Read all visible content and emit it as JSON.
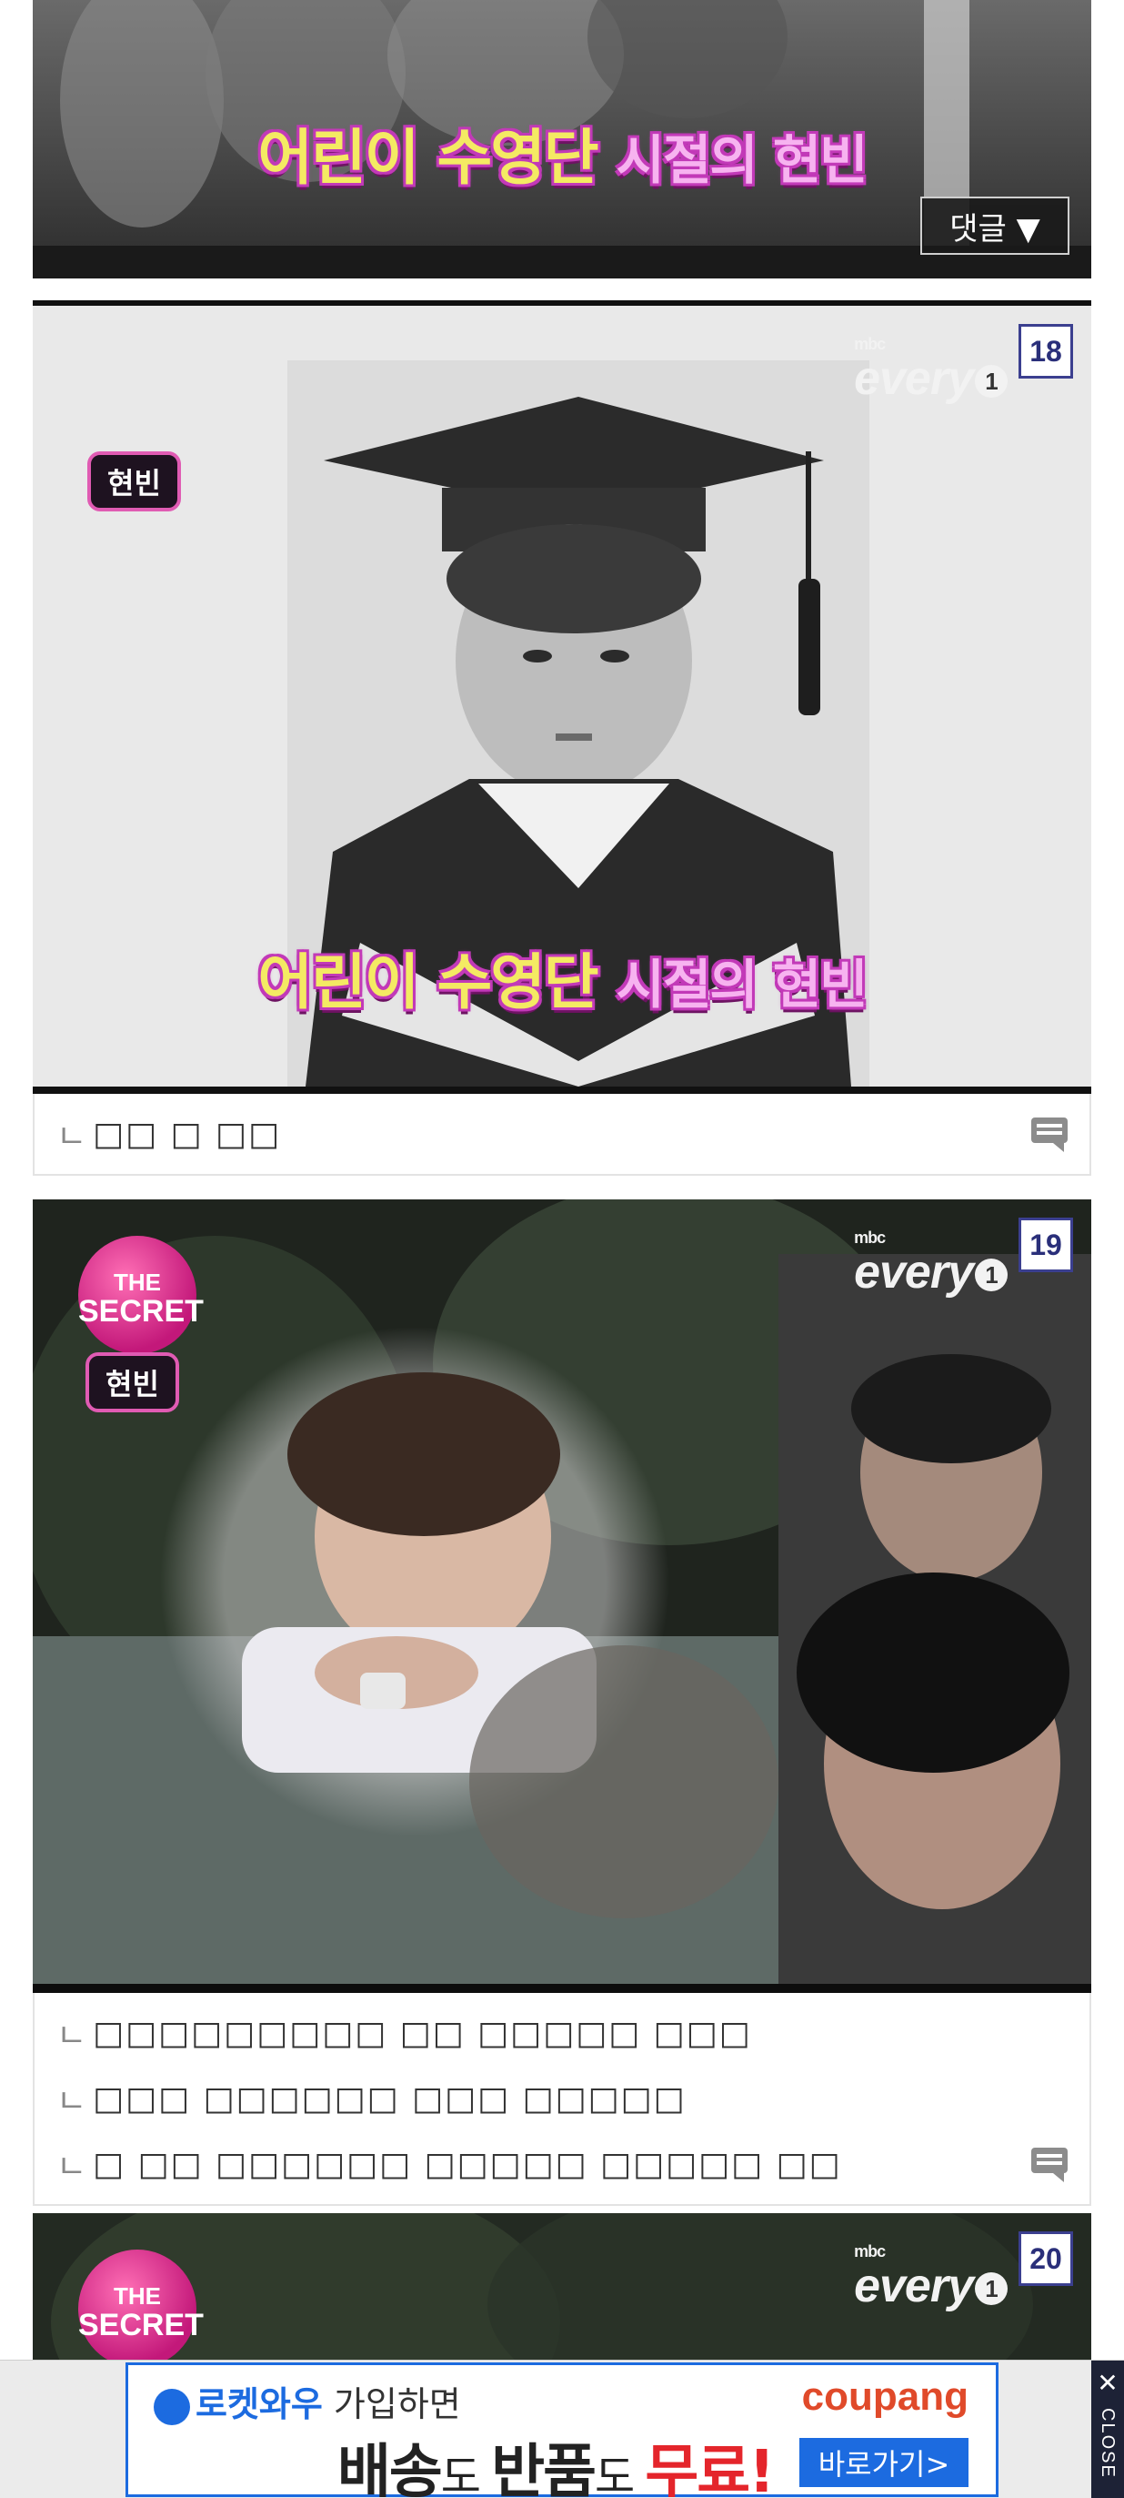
{
  "cards": [
    {
      "caption_white": "어린이 수영단",
      "caption_pink": "시절의 현빈",
      "comment_button": "댓글 ▼"
    },
    {
      "number": "18",
      "name_tag": "현빈",
      "caption_white": "어린이 수영단",
      "caption_pink": "시절의 현빈",
      "comments": [
        "ㄴ",
        "□□ □ □□"
      ]
    },
    {
      "number": "19",
      "secret_top": "THE",
      "secret_bottom": "SECRET",
      "name_tag": "현빈",
      "comments": [
        {
          "arrow": "ㄴ",
          "text": "□□□□□□□□□ □□ □□□□□ □□□"
        },
        {
          "arrow": "ㄴ",
          "text": "□□□ □□□□□□ □□□ □□□□□"
        },
        {
          "arrow": "ㄴ",
          "text": "□ □□ □□□□□□ □□□□□ □□□□□ □□"
        }
      ]
    },
    {
      "number": "20",
      "secret_top": "THE",
      "secret_bottom": "SECRET"
    }
  ],
  "logo": {
    "small": "mbc",
    "main": "every",
    "one": "1"
  },
  "ad": {
    "rocket": "로켓와우",
    "join": " 가입하면",
    "l2a": "배송",
    "l2b": "도 ",
    "l2c": "반품",
    "l2d": "도 ",
    "l2e": "무료!",
    "brand": "coupang",
    "go": "바로가기>",
    "close_x": "✕",
    "close_word": "CLOSE"
  },
  "colors": {
    "badge_border": "#3b3f8f",
    "caption_yellow": "#f4ea63",
    "caption_pink": "#f7b3f0",
    "ad_blue": "#1c6be0",
    "ad_red": "#e4252b"
  }
}
